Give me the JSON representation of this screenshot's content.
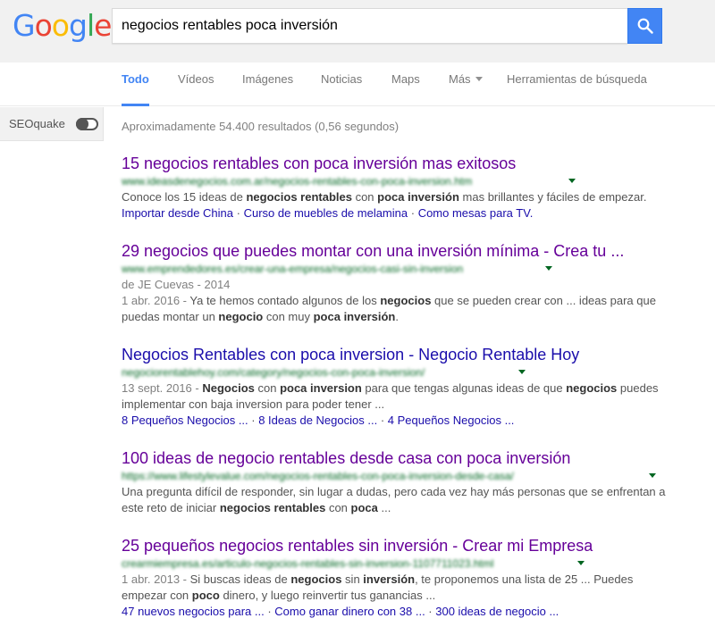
{
  "logo": {
    "letters": [
      {
        "ch": "G",
        "color": "#4285f4"
      },
      {
        "ch": "o",
        "color": "#ea4335"
      },
      {
        "ch": "o",
        "color": "#fbbc05"
      },
      {
        "ch": "g",
        "color": "#4285f4"
      },
      {
        "ch": "l",
        "color": "#34a853"
      },
      {
        "ch": "e",
        "color": "#ea4335"
      }
    ]
  },
  "search": {
    "value": "negocios rentables poca inversión",
    "button_icon": "search-icon",
    "button_color": "#4285f4"
  },
  "nav": {
    "tabs": [
      {
        "label": "Todo"
      },
      {
        "label": "Vídeos"
      },
      {
        "label": "Imágenes"
      },
      {
        "label": "Noticias"
      },
      {
        "label": "Maps"
      },
      {
        "label": "Más"
      },
      {
        "label": "Herramientas de búsqueda"
      }
    ],
    "active_tab": "Todo",
    "accent": "#4285f4"
  },
  "sidebar": {
    "seoquake_label": "SEOquake",
    "toggle_icon": "toggle-switch-icon"
  },
  "stats": "Aproximadamente 54.400 resultados (0,56 segundos)",
  "results": [
    {
      "title": "15 negocios rentables con poca inversión mas exitosos",
      "url": "www.ideasdenegocios.com.ar/negocios-rentables-con-poca-inversion.htm",
      "snippet_parts": [
        {
          "t": "Conoce los 15 ideas de "
        },
        {
          "t": "negocios rentables",
          "b": true
        },
        {
          "t": " con "
        },
        {
          "t": "poca inversión",
          "b": true
        },
        {
          "t": " mas brillantes y fáciles de empezar."
        }
      ],
      "sitelinks": [
        "Importar desde China",
        "Curso de muebles de melamina",
        "Como mesas para TV."
      ]
    },
    {
      "title": "29 negocios que puedes montar con una inversión mínima - Crea tu ...",
      "url": "www.emprendedores.es/crear-una-empresa/negocios-casi-sin-inversion",
      "author": "de JE Cuevas - 2014",
      "date": "1 abr. 2016",
      "snippet_parts": [
        {
          "t": "Ya te hemos contado algunos de los "
        },
        {
          "t": "negocios",
          "b": true
        },
        {
          "t": " que se pueden crear con ... ideas para que puedas montar un "
        },
        {
          "t": "negocio",
          "b": true
        },
        {
          "t": " con muy "
        },
        {
          "t": "poca inversión",
          "b": true
        },
        {
          "t": "."
        }
      ]
    },
    {
      "title": "Negocios Rentables con poca inversion - Negocio Rentable Hoy",
      "url": "negociorentablehoy.com/category/negocios-con-poca-inversion/",
      "date": "13 sept. 2016",
      "snippet_parts": [
        {
          "t": "Negocios",
          "b": true
        },
        {
          "t": " con "
        },
        {
          "t": "poca inversion",
          "b": true
        },
        {
          "t": " para que tengas algunas ideas de que "
        },
        {
          "t": "negocios",
          "b": true
        },
        {
          "t": " puedes implementar con baja inversion para poder tener ..."
        }
      ],
      "sitelinks": [
        "8 Pequeños Negocios ...",
        "8 Ideas de Negocios ...",
        "4 Pequeños Negocios ..."
      ]
    },
    {
      "title": "100 ideas de negocio rentables desde casa con poca inversión",
      "url": "https://www.lifestylevalue.com/negocios-rentables-con-poca-inversion-desde-casa/",
      "snippet_parts": [
        {
          "t": "Una pregunta difícil de responder, sin lugar a dudas, pero cada vez hay más personas que se enfrentan a este reto de iniciar "
        },
        {
          "t": "negocios rentables",
          "b": true
        },
        {
          "t": " con "
        },
        {
          "t": "poca",
          "b": true
        },
        {
          "t": " ..."
        }
      ]
    },
    {
      "title": "25 pequeños negocios rentables sin inversión - Crear mi Empresa",
      "url": "crearmiempresa.es/articulo-negocios-rentables-sin-inversion-1107711023.html",
      "date": "1 abr. 2013",
      "snippet_parts": [
        {
          "t": "Si buscas ideas de "
        },
        {
          "t": "negocios",
          "b": true
        },
        {
          "t": " sin "
        },
        {
          "t": "inversión",
          "b": true
        },
        {
          "t": ", te proponemos una lista de 25 ... Puedes empezar con "
        },
        {
          "t": "poco",
          "b": true
        },
        {
          "t": " dinero, y luego reinvertir tus ganancias ..."
        }
      ],
      "sitelinks": [
        "47 nuevos negocios para ...",
        "Como ganar dinero con 38 ...",
        "300 ideas de negocio ..."
      ]
    }
  ],
  "colors": {
    "visited_link": "#660099",
    "link": "#1a0dab",
    "url_green": "#006621"
  }
}
